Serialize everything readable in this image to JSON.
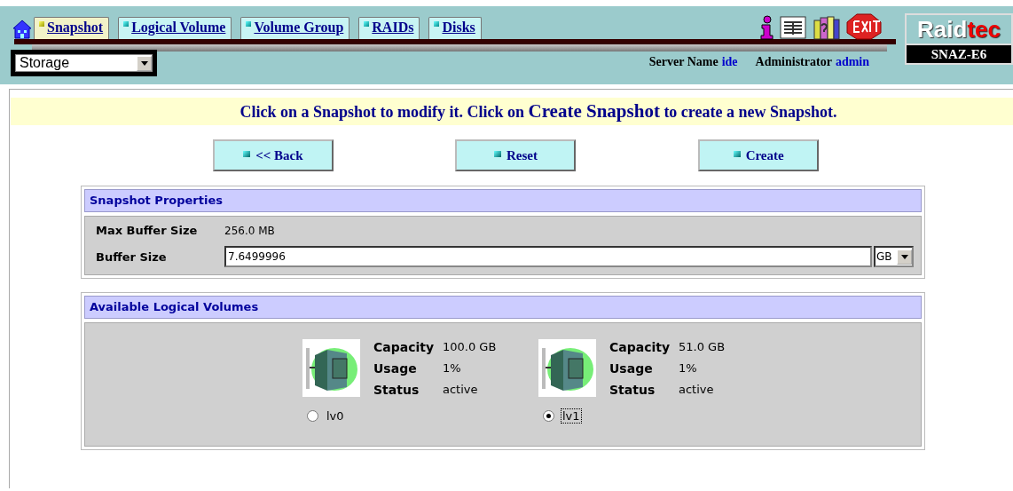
{
  "tabs": [
    {
      "label": "Snapshot",
      "selected": true
    },
    {
      "label": "Logical Volume",
      "selected": false
    },
    {
      "label": "Volume Group",
      "selected": false
    },
    {
      "label": "RAIDs",
      "selected": false
    },
    {
      "label": "Disks",
      "selected": false
    }
  ],
  "category_select": {
    "value": "Storage"
  },
  "server": {
    "label": "Server Name",
    "value": "ide"
  },
  "admin": {
    "label": "Administrator",
    "value": "admin"
  },
  "brand": {
    "logo_start": "Raid",
    "logo_end": "tec",
    "model": "SNAZ-E6"
  },
  "banner": {
    "text": "Click on a Snapshot to modify it. Click on **Create Snapshot** to create a new Snapshot."
  },
  "buttons": [
    "<< Back",
    "Reset",
    "Create"
  ],
  "properties": {
    "title": "Snapshot Properties",
    "max_label": "Max Buffer Size",
    "max_value": "256.0 MB",
    "buffer_label": "Buffer Size",
    "buffer_value": "7.6499996",
    "unit": "GB"
  },
  "volumes": {
    "title": "Available Logical Volumes",
    "items": [
      {
        "name": "lv0",
        "selected": false,
        "fields": [
          {
            "label": "Capacity",
            "value": "100.0 GB"
          },
          {
            "label": "Usage",
            "value": "1%"
          },
          {
            "label": "Status",
            "value": "active"
          }
        ]
      },
      {
        "name": "lv1",
        "selected": true,
        "fields": [
          {
            "label": "Capacity",
            "value": "51.0 GB"
          },
          {
            "label": "Usage",
            "value": "1%"
          },
          {
            "label": "Status",
            "value": "active"
          }
        ]
      }
    ]
  }
}
